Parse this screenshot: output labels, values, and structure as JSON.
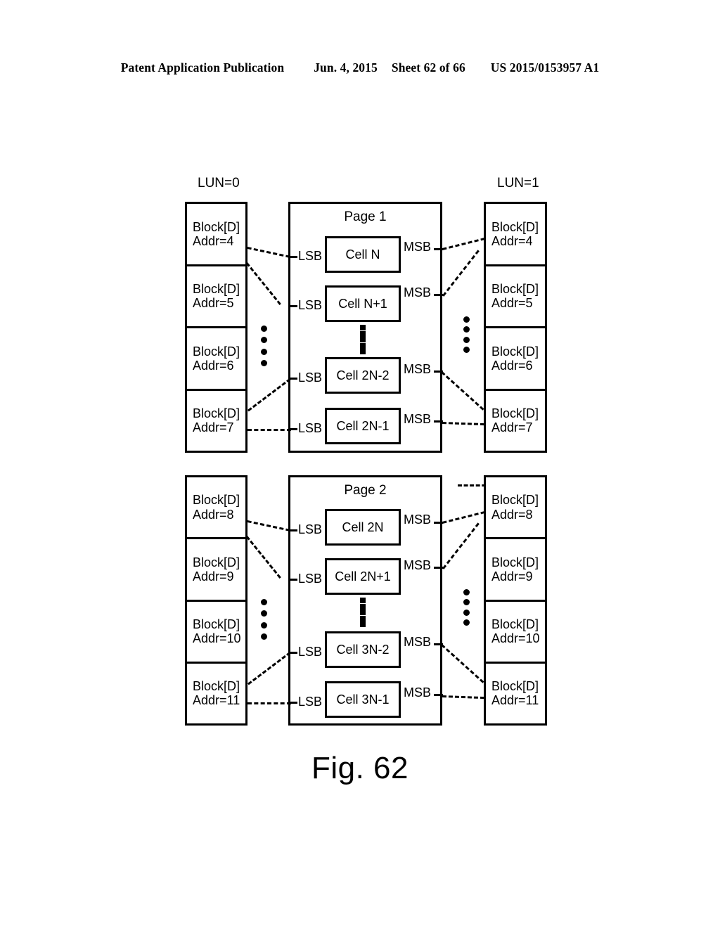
{
  "header": {
    "publication": "Patent Application Publication",
    "date": "Jun. 4, 2015",
    "sheet": "Sheet 62 of 66",
    "patent_number": "US 2015/0153957 A1"
  },
  "figure": {
    "caption": "Fig. 62",
    "lun_left_label": "LUN=0",
    "lun_right_label": "LUN=1",
    "lsb_label": "LSB",
    "msb_label": "MSB",
    "ellipsis_dot_count": 4,
    "page_ellipsis_dot_count": 5,
    "line_color": "#000000",
    "background_color": "#ffffff"
  },
  "groups": [
    {
      "page_title": "Page 1",
      "left_blocks": [
        {
          "line1": "Block[D]",
          "line2": "Addr=4"
        },
        {
          "line1": "Block[D]",
          "line2": "Addr=5"
        },
        {
          "line1": "Block[D]",
          "line2": "Addr=6"
        },
        {
          "line1": "Block[D]",
          "line2": "Addr=7"
        }
      ],
      "right_blocks": [
        {
          "line1": "Block[D]",
          "line2": "Addr=4"
        },
        {
          "line1": "Block[D]",
          "line2": "Addr=5"
        },
        {
          "line1": "Block[D]",
          "line2": "Addr=6"
        },
        {
          "line1": "Block[D]",
          "line2": "Addr=7"
        }
      ],
      "cells": [
        {
          "label": "Cell N",
          "lsb": "LSB",
          "msb": "MSB"
        },
        {
          "label": "Cell N+1",
          "lsb": "LSB",
          "msb": "MSB"
        },
        {
          "label": "Cell 2N-2",
          "lsb": "LSB",
          "msb": "MSB"
        },
        {
          "label": "Cell 2N-1",
          "lsb": "LSB",
          "msb": "MSB"
        }
      ]
    },
    {
      "page_title": "Page 2",
      "left_blocks": [
        {
          "line1": "Block[D]",
          "line2": "Addr=8"
        },
        {
          "line1": "Block[D]",
          "line2": "Addr=9"
        },
        {
          "line1": "Block[D]",
          "line2": "Addr=10"
        },
        {
          "line1": "Block[D]",
          "line2": "Addr=11"
        }
      ],
      "right_blocks": [
        {
          "line1": "Block[D]",
          "line2": "Addr=8"
        },
        {
          "line1": "Block[D]",
          "line2": "Addr=9"
        },
        {
          "line1": "Block[D]",
          "line2": "Addr=10"
        },
        {
          "line1": "Block[D]",
          "line2": "Addr=11"
        }
      ],
      "cells": [
        {
          "label": "Cell 2N",
          "lsb": "LSB",
          "msb": "MSB"
        },
        {
          "label": "Cell 2N+1",
          "lsb": "LSB",
          "msb": "MSB"
        },
        {
          "label": "Cell 3N-2",
          "lsb": "LSB",
          "msb": "MSB"
        },
        {
          "label": "Cell 3N-1",
          "lsb": "LSB",
          "msb": "MSB"
        }
      ]
    }
  ]
}
